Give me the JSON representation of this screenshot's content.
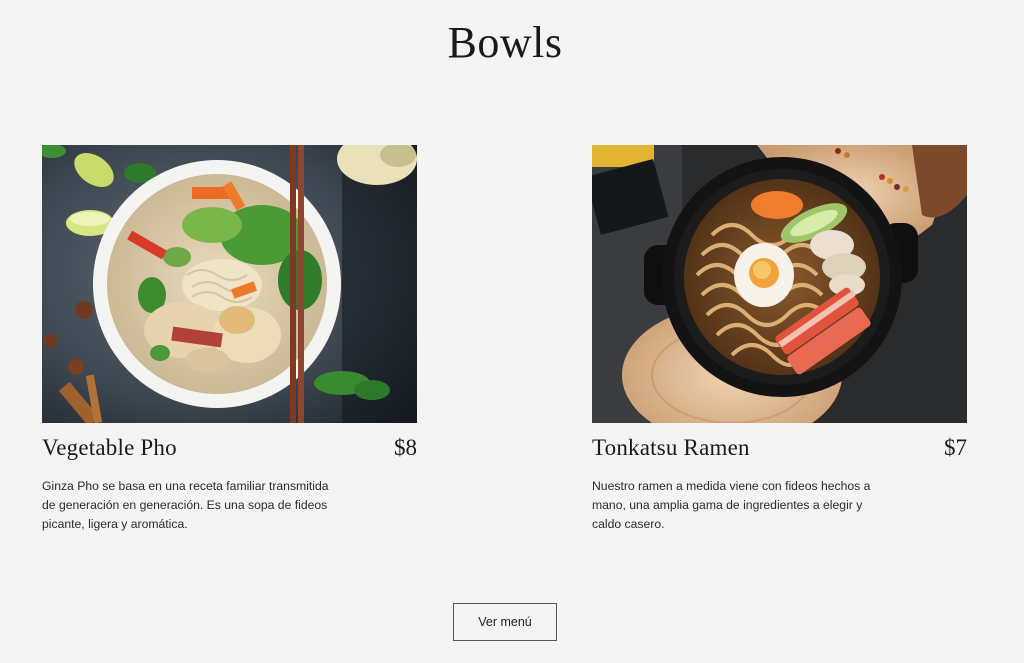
{
  "section": {
    "title": "Bowls"
  },
  "dishes": [
    {
      "name": "Vegetable Pho",
      "price": "$8",
      "description": "Ginza Pho se basa en una receta familiar transmitida de generación en generación. Es una sopa de fideos picante, ligera y aromática.",
      "image_icon": "pho-bowl-photo"
    },
    {
      "name": "Tonkatsu Ramen",
      "price": "$7",
      "description": "Nuestro ramen a medida viene con fideos hechos a mano, una amplia gama de ingredientes a elegir y caldo casero.",
      "image_icon": "ramen-bowl-photo"
    }
  ],
  "cta": {
    "label": "Ver menú"
  }
}
